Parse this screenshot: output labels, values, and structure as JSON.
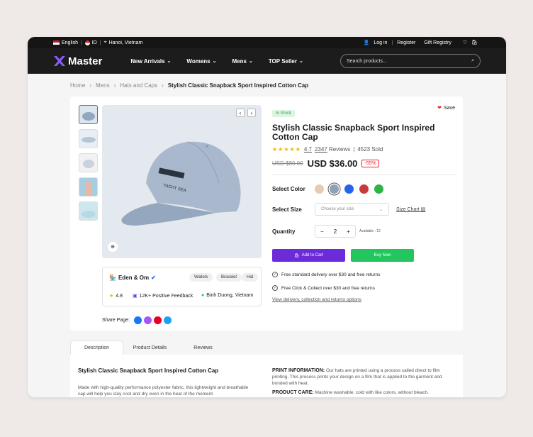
{
  "topbar": {
    "language": "English",
    "currency": "ID",
    "location": "Hanoi, Vietnam",
    "login": "Log in",
    "register": "Register",
    "gift": "Gift Registry"
  },
  "nav": {
    "brand": "Master",
    "items": [
      "New Arrivals",
      "Womens",
      "Mens",
      "TOP Seller"
    ],
    "search_placeholder": "Search products..."
  },
  "breadcrumb": [
    "Home",
    "Mens",
    "Hats and Caps",
    "Stylish Classic Snapback Sport Inspired Cotton Cap"
  ],
  "product": {
    "stock": "In Stock",
    "save": "Save",
    "title": "Stylish Classic Snapback Sport Inspired Cotton Cap",
    "rating": "4.7",
    "reviews": "2347",
    "reviews_label": "Reviews",
    "sold": "4523 Sold",
    "old_price": "USD $80.00",
    "price": "USD $36.00",
    "discount": "-55%",
    "color_label": "Select Color",
    "size_label": "Select Size",
    "size_placeholder": "Choose your size",
    "size_chart": "Size Chart",
    "qty_label": "Quantity",
    "qty": "2",
    "available": "Available : 12",
    "add_to_cart": "Add to Cart",
    "buy_now": "Buy Now",
    "features": [
      "Free standard delivery over $30 and free returns",
      "Free Click & Collect over $30 and free returns"
    ],
    "link": "View delivery, collection and returns options",
    "colors": [
      "#e6ccb4",
      "#8e9fb6",
      "#2563eb",
      "#c93a3a",
      "#2fb344"
    ]
  },
  "seller": {
    "name": "Eden & Om",
    "tags": [
      "Wallets",
      "Bracelet",
      "Hat"
    ],
    "rating": "4.8",
    "feedback": "12K+ Positive Feedback",
    "location": "Binh Duong, Vietnam",
    "share": "Share Page:"
  },
  "tabs": [
    "Description",
    "Product Details",
    "Reviews"
  ],
  "description": {
    "title": "Stylish Classic Snapback Sport Inspired Cotton Cap",
    "text": "Made with high-quality performance polyester fabric, this lightweight and breathable cap will help you stay cool and dry even in the heat of the moment.",
    "print_h": "PRINT INFORMATION:",
    "print": " Our hats are printed using a process called direct to film printing. This process prints your design on a film that is applied to the garment and bonded with heat.",
    "care_h": "PRODUCT CARE:",
    "care": " Machine washable, cold with like colors, without bleach."
  }
}
